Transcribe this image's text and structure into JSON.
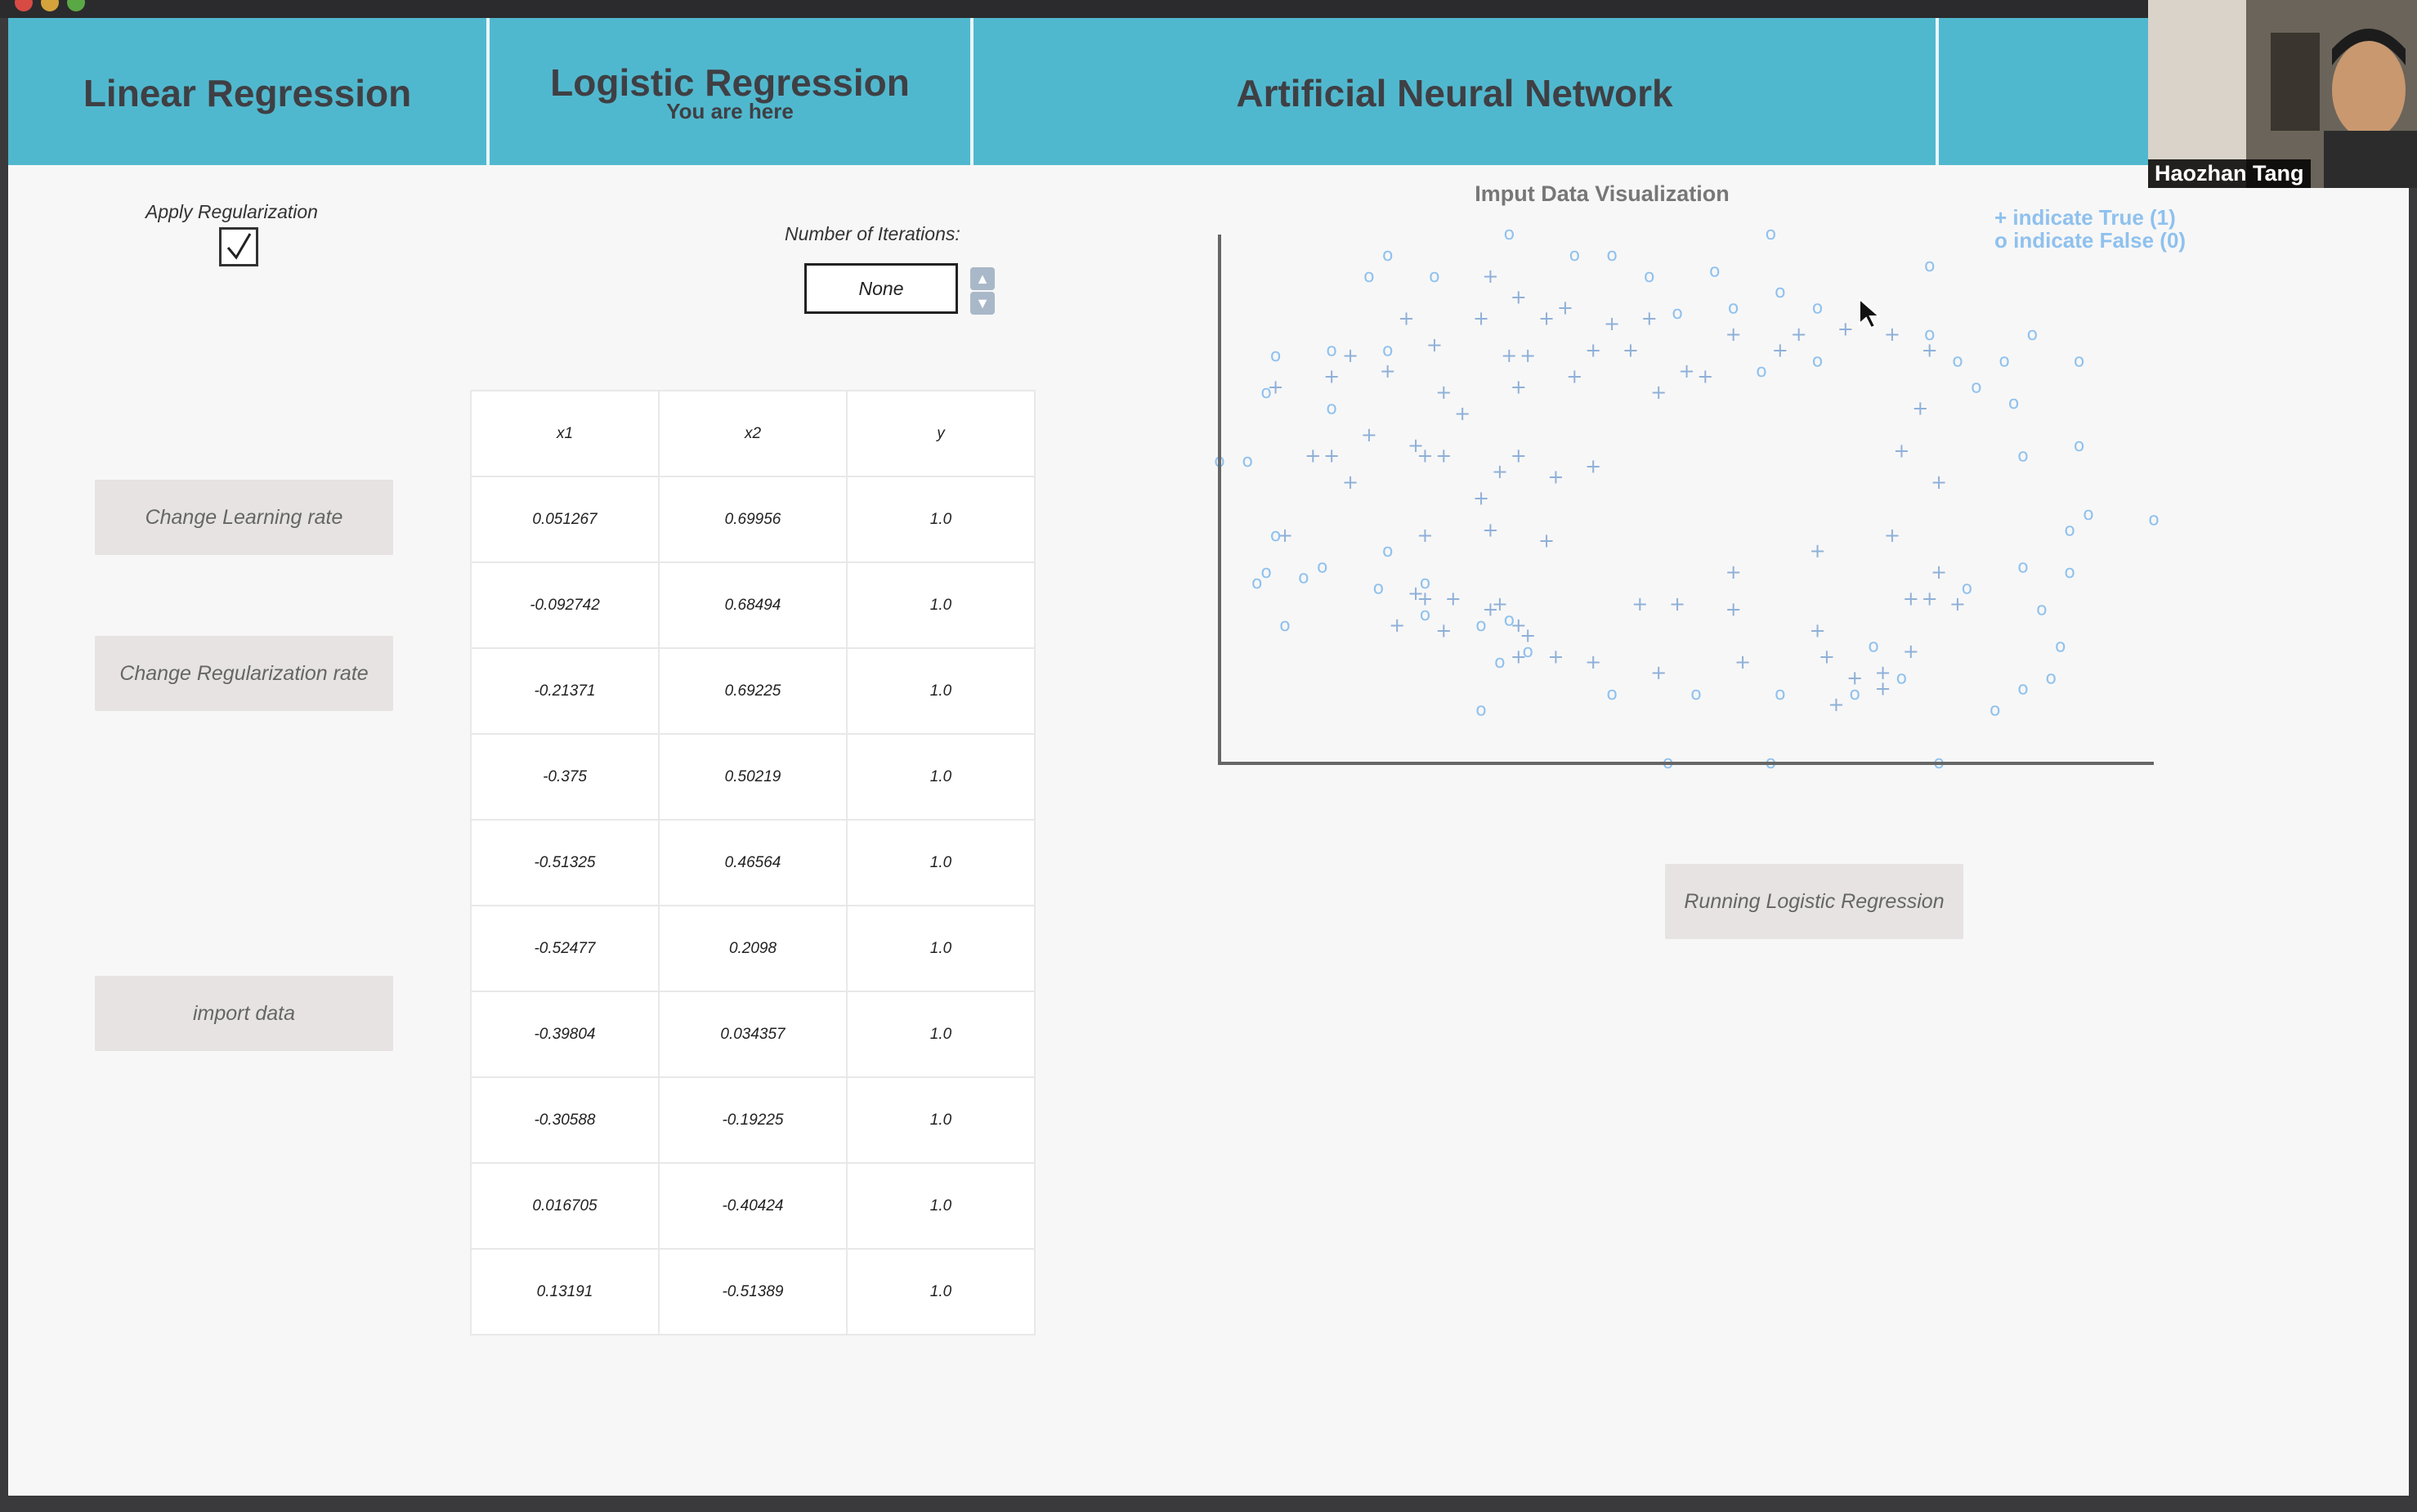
{
  "nav": {
    "tabs": [
      {
        "label": "Linear Regression",
        "sub": ""
      },
      {
        "label": "Logistic Regression",
        "sub": "You are here"
      },
      {
        "label": "Artificial Neural Network",
        "sub": ""
      },
      {
        "label": "",
        "sub": ""
      }
    ]
  },
  "controls": {
    "regularization_label": "Apply Regularization",
    "regularization_checked": true,
    "change_learning_rate": "Change Learning rate",
    "change_regularization_rate": "Change Regularization rate",
    "import_data": "import data",
    "iterations_label": "Number of Iterations:",
    "iterations_value": "None",
    "run_button": "Running Logistic Regression"
  },
  "table": {
    "headers": [
      "x1",
      "x2",
      "y"
    ],
    "rows": [
      [
        "0.051267",
        "0.69956",
        "1.0"
      ],
      [
        "-0.092742",
        "0.68494",
        "1.0"
      ],
      [
        "-0.21371",
        "0.69225",
        "1.0"
      ],
      [
        "-0.375",
        "0.50219",
        "1.0"
      ],
      [
        "-0.51325",
        "0.46564",
        "1.0"
      ],
      [
        "-0.52477",
        "0.2098",
        "1.0"
      ],
      [
        "-0.39804",
        "0.034357",
        "1.0"
      ],
      [
        "-0.30588",
        "-0.19225",
        "1.0"
      ],
      [
        "0.016705",
        "-0.40424",
        "1.0"
      ],
      [
        "0.13191",
        "-0.51389",
        "1.0"
      ]
    ]
  },
  "chart_data": {
    "type": "scatter",
    "title": "Imput Data Visualization",
    "legend": [
      "+ indicate True (1)",
      "o indicate False (0)"
    ],
    "legend_position": "top-right",
    "xlim": [
      0,
      1
    ],
    "ylim": [
      0,
      1
    ],
    "grid": false,
    "series": [
      {
        "name": "+ indicate True (1)",
        "marker": "+",
        "color": "#8fb0d8",
        "points": [
          [
            0.29,
            0.92
          ],
          [
            0.28,
            0.84
          ],
          [
            0.2,
            0.84
          ],
          [
            0.35,
            0.84
          ],
          [
            0.37,
            0.86
          ],
          [
            0.4,
            0.78
          ],
          [
            0.33,
            0.77
          ],
          [
            0.31,
            0.77
          ],
          [
            0.23,
            0.79
          ],
          [
            0.14,
            0.77
          ],
          [
            0.18,
            0.74
          ],
          [
            0.12,
            0.73
          ],
          [
            0.24,
            0.7
          ],
          [
            0.32,
            0.71
          ],
          [
            0.38,
            0.73
          ],
          [
            0.26,
            0.66
          ],
          [
            0.32,
            0.58
          ],
          [
            0.1,
            0.58
          ],
          [
            0.16,
            0.62
          ],
          [
            0.21,
            0.6
          ],
          [
            0.24,
            0.58
          ],
          [
            0.06,
            0.71
          ],
          [
            0.14,
            0.53
          ],
          [
            0.12,
            0.58
          ],
          [
            0.22,
            0.58
          ],
          [
            0.28,
            0.5
          ],
          [
            0.3,
            0.55
          ],
          [
            0.36,
            0.54
          ],
          [
            0.4,
            0.56
          ],
          [
            0.46,
            0.84
          ],
          [
            0.5,
            0.74
          ],
          [
            0.52,
            0.73
          ],
          [
            0.55,
            0.81
          ],
          [
            0.44,
            0.78
          ],
          [
            0.3,
            0.3
          ],
          [
            0.25,
            0.31
          ],
          [
            0.21,
            0.32
          ],
          [
            0.19,
            0.26
          ],
          [
            0.32,
            0.26
          ],
          [
            0.24,
            0.25
          ],
          [
            0.36,
            0.2
          ],
          [
            0.22,
            0.31
          ],
          [
            0.32,
            0.2
          ],
          [
            0.47,
            0.17
          ],
          [
            0.55,
            0.29
          ],
          [
            0.4,
            0.19
          ],
          [
            0.29,
            0.29
          ],
          [
            0.56,
            0.19
          ],
          [
            0.45,
            0.3
          ],
          [
            0.33,
            0.24
          ],
          [
            0.07,
            0.43
          ],
          [
            0.22,
            0.43
          ],
          [
            0.62,
            0.81
          ],
          [
            0.6,
            0.78
          ],
          [
            0.67,
            0.82
          ],
          [
            0.75,
            0.67
          ],
          [
            0.72,
            0.81
          ],
          [
            0.73,
            0.59
          ],
          [
            0.77,
            0.53
          ],
          [
            0.76,
            0.78
          ],
          [
            0.68,
            0.16
          ],
          [
            0.71,
            0.17
          ],
          [
            0.74,
            0.31
          ],
          [
            0.77,
            0.36
          ],
          [
            0.74,
            0.21
          ],
          [
            0.66,
            0.11
          ],
          [
            0.72,
            0.43
          ],
          [
            0.76,
            0.31
          ],
          [
            0.55,
            0.36
          ],
          [
            0.49,
            0.3
          ],
          [
            0.35,
            0.42
          ],
          [
            0.29,
            0.44
          ],
          [
            0.64,
            0.25
          ],
          [
            0.79,
            0.3
          ],
          [
            0.64,
            0.4
          ],
          [
            0.65,
            0.2
          ],
          [
            0.42,
            0.83
          ],
          [
            0.32,
            0.88
          ],
          [
            0.47,
            0.7
          ],
          [
            0.71,
            0.14
          ]
        ]
      },
      {
        "name": "o indicate False (0)",
        "marker": "o",
        "color": "#8fc1ee",
        "points": [
          [
            0.18,
            0.96
          ],
          [
            0.16,
            0.92
          ],
          [
            0.23,
            0.92
          ],
          [
            0.38,
            0.96
          ],
          [
            0.42,
            0.96
          ],
          [
            0.46,
            0.92
          ],
          [
            0.53,
            0.93
          ],
          [
            0.6,
            0.89
          ],
          [
            0.64,
            0.86
          ],
          [
            0.55,
            0.86
          ],
          [
            0.49,
            0.85
          ],
          [
            0.64,
            0.76
          ],
          [
            0.58,
            0.74
          ],
          [
            0.06,
            0.77
          ],
          [
            0.05,
            0.7
          ],
          [
            0.12,
            0.78
          ],
          [
            0.18,
            0.78
          ],
          [
            0.12,
            0.67
          ],
          [
            0.03,
            0.57
          ],
          [
            0.06,
            0.43
          ],
          [
            0.11,
            0.37
          ],
          [
            0.18,
            0.4
          ],
          [
            0.04,
            0.34
          ],
          [
            0.09,
            0.35
          ],
          [
            0.07,
            0.26
          ],
          [
            0.22,
            0.28
          ],
          [
            0.17,
            0.33
          ],
          [
            0.22,
            0.34
          ],
          [
            0.28,
            0.26
          ],
          [
            0.31,
            0.27
          ],
          [
            0.3,
            0.19
          ],
          [
            0.33,
            0.21
          ],
          [
            0.28,
            0.1
          ],
          [
            0.42,
            0.13
          ],
          [
            0.51,
            0.13
          ],
          [
            0.6,
            0.13
          ],
          [
            0.68,
            0.13
          ],
          [
            0.7,
            0.22
          ],
          [
            0.76,
            0.94
          ],
          [
            0.76,
            0.81
          ],
          [
            0.79,
            0.76
          ],
          [
            0.81,
            0.71
          ],
          [
            0.84,
            0.76
          ],
          [
            0.85,
            0.68
          ],
          [
            0.86,
            0.58
          ],
          [
            0.87,
            0.81
          ],
          [
            0.92,
            0.76
          ],
          [
            0.92,
            0.6
          ],
          [
            0.91,
            0.44
          ],
          [
            0.93,
            0.47
          ],
          [
            0.91,
            0.36
          ],
          [
            0.9,
            0.22
          ],
          [
            0.89,
            0.16
          ],
          [
            0.86,
            0.14
          ],
          [
            0.83,
            0.1
          ],
          [
            0.77,
            0.0
          ],
          [
            0.88,
            0.29
          ],
          [
            0.86,
            0.37
          ],
          [
            0.73,
            0.16
          ],
          [
            0.59,
            1.0
          ],
          [
            0.31,
            1.0
          ],
          [
            0.0,
            0.57
          ],
          [
            0.48,
            0.0
          ],
          [
            0.59,
            0.0
          ],
          [
            1.0,
            0.46
          ],
          [
            0.8,
            0.33
          ],
          [
            0.05,
            0.36
          ]
        ]
      }
    ]
  },
  "webcam": {
    "name": "Haozhan Tang"
  },
  "colors": {
    "nav_bg": "#50b8ce",
    "accent_text": "#8fc1ee"
  }
}
